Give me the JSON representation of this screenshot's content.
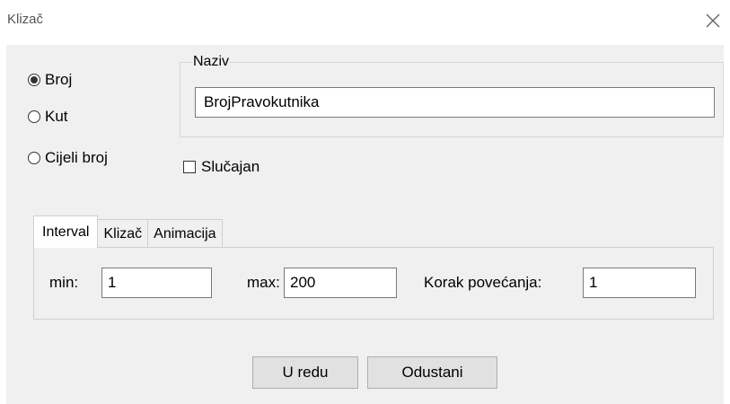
{
  "window": {
    "title": "Klizač",
    "close_icon": "close-icon"
  },
  "type": {
    "options": [
      {
        "label": "Broj",
        "checked": true
      },
      {
        "label": "Kut",
        "checked": false
      },
      {
        "label": "Cijeli broj",
        "checked": false
      }
    ]
  },
  "name": {
    "legend": "Naziv",
    "value": "BrojPravokutnika"
  },
  "random": {
    "label": "Slučajan",
    "checked": false
  },
  "tabs": [
    {
      "label": "Interval",
      "active": true
    },
    {
      "label": "Klizač",
      "active": false
    },
    {
      "label": "Animacija",
      "active": false
    }
  ],
  "interval": {
    "min_label": "min:",
    "min_value": "1",
    "max_label": "max:",
    "max_value": "200",
    "step_label": "Korak povećanja:",
    "step_value": "1"
  },
  "buttons": {
    "ok": "U redu",
    "cancel": "Odustani"
  }
}
